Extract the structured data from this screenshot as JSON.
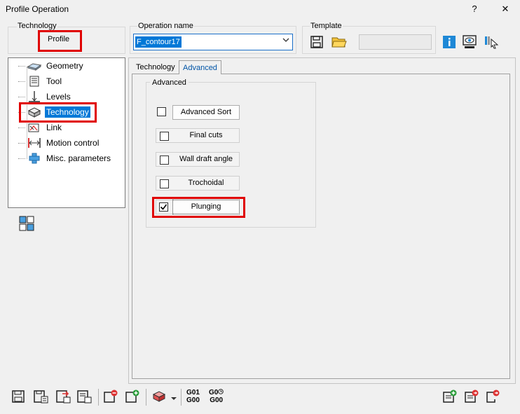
{
  "window": {
    "title": "Profile Operation",
    "help": "?",
    "close": "✕"
  },
  "technology_group": {
    "label": "Technology",
    "value": "Profile"
  },
  "operation_name": {
    "label": "Operation name",
    "value": "F_contour17"
  },
  "template": {
    "label": "Template",
    "field_value": ""
  },
  "tree": {
    "items": [
      {
        "label": "Geometry",
        "icon": "geometry-icon"
      },
      {
        "label": "Tool",
        "icon": "tool-icon"
      },
      {
        "label": "Levels",
        "icon": "levels-icon"
      },
      {
        "label": "Technology",
        "icon": "technology-icon",
        "selected": true
      },
      {
        "label": "Link",
        "icon": "link-icon"
      },
      {
        "label": "Motion control",
        "icon": "motion-control-icon"
      },
      {
        "label": "Misc. parameters",
        "icon": "misc-parameters-icon"
      }
    ]
  },
  "tabs": [
    {
      "label": "Technology",
      "active": false
    },
    {
      "label": "Advanced",
      "active": true
    }
  ],
  "advanced": {
    "group_label": "Advanced",
    "options": [
      {
        "label": "Advanced Sort",
        "checked": false
      },
      {
        "label": "Final cuts",
        "checked": false
      },
      {
        "label": "Wall draft angle",
        "checked": false
      },
      {
        "label": "Trochoidal",
        "checked": false
      },
      {
        "label": "Plunging",
        "checked": true
      }
    ]
  },
  "bottom_toolbar": {
    "g01": "G01",
    "g00": "G00",
    "g0s": "G0",
    "g00b": "G00"
  },
  "colors": {
    "accent": "#0078d7",
    "highlight": "#e00000"
  }
}
